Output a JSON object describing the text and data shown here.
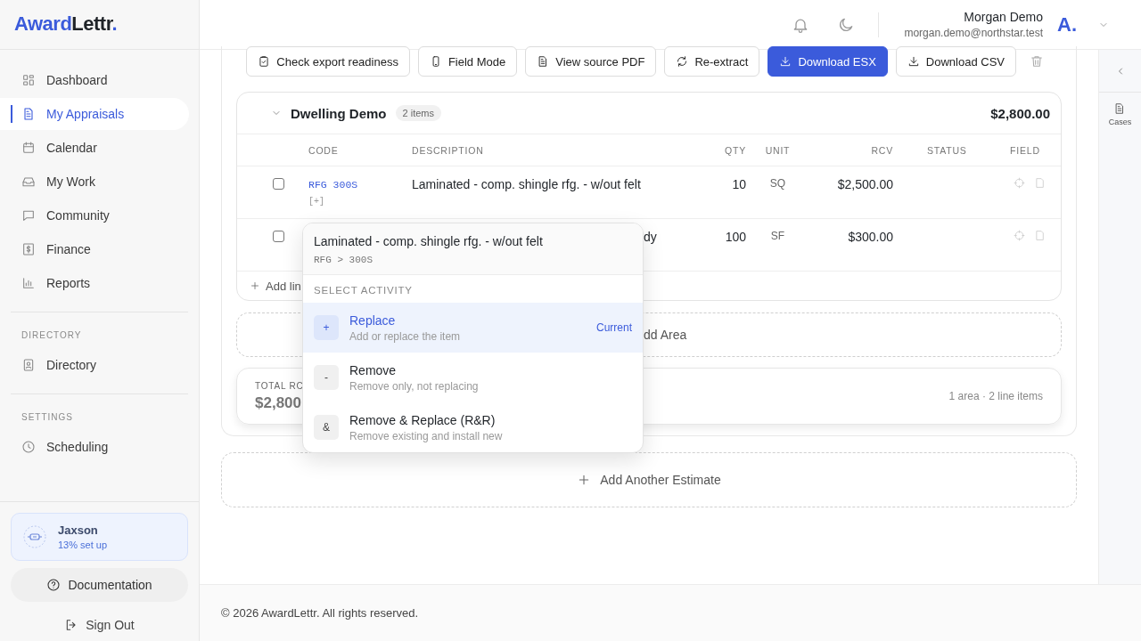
{
  "sidebar": {
    "logo": {
      "first": "Award",
      "second": "Lettr",
      "dot": "."
    },
    "sections": [
      {
        "items": [
          {
            "label": "Dashboard",
            "selected": false
          },
          {
            "label": "My Appraisals",
            "selected": true
          },
          {
            "label": "Calendar",
            "selected": false
          },
          {
            "label": "My Work",
            "selected": false
          },
          {
            "label": "Community",
            "selected": false
          },
          {
            "label": "Finance",
            "selected": false
          },
          {
            "label": "Reports",
            "selected": false
          }
        ]
      },
      {
        "heading": "DIRECTORY",
        "items": [
          {
            "label": "Directory",
            "selected": false
          }
        ]
      },
      {
        "heading": "SETTINGS",
        "items": [
          {
            "label": "Scheduling",
            "selected": false
          }
        ]
      }
    ],
    "assistant": {
      "name": "Jaxson",
      "subtitle": "13% set up"
    },
    "documentation": "Documentation",
    "sign_out": "Sign Out"
  },
  "header": {
    "user_name": "Morgan Demo",
    "user_email": "morgan.demo@northstar.test",
    "avatar_text": "A."
  },
  "toolbar": [
    {
      "label": "Check export readiness",
      "kind": "default"
    },
    {
      "label": "Field Mode",
      "kind": "default"
    },
    {
      "label": "View source PDF",
      "kind": "default"
    },
    {
      "label": "Re-extract",
      "kind": "default"
    },
    {
      "label": "Download ESX",
      "kind": "primary"
    },
    {
      "label": "Download CSV",
      "kind": "default"
    }
  ],
  "area": {
    "title": "Dwelling Demo",
    "count": "2 items",
    "total": "$2,800.00",
    "expanded": true,
    "columns": [
      "CODE",
      "DESCRIPTION",
      "QTY",
      "UNIT",
      "RCV",
      "STATUS",
      "FIELD"
    ],
    "rows": [
      {
        "checked": false,
        "code": "RFG 300S",
        "code_note": "[+]",
        "description": "Laminated - comp. shingle rfg. - w/out felt",
        "qty": "10",
        "unit": "SQ",
        "rcv": "$2,500.00"
      },
      {
        "checked": false,
        "description": "dy",
        "qty": "100",
        "unit": "SF",
        "rcv": "$300.00"
      }
    ],
    "add_line": "Add lin"
  },
  "add_area": "dd Area",
  "totals": {
    "label": "TOTAL RC",
    "amount": "$2,800",
    "summary": "1 area · 2 line items"
  },
  "add_estimate": "Add Another Estimate",
  "popover": {
    "title": "Laminated - comp. shingle rfg. - w/out felt",
    "path": "RFG > 300S",
    "heading": "SELECT ACTIVITY",
    "options": [
      {
        "symbol": "+",
        "label": "Replace",
        "hint": "Add or replace the item",
        "badge": "Current",
        "selected": true
      },
      {
        "symbol": "-",
        "label": "Remove",
        "hint": "Remove only, not replacing",
        "selected": false
      },
      {
        "symbol": "&",
        "label": "Remove & Replace (R&R)",
        "hint": "Remove existing and install new",
        "selected": false
      }
    ]
  },
  "right_rail": {
    "label": "Cases"
  },
  "footer": "© 2026 AwardLettr. All rights reserved."
}
